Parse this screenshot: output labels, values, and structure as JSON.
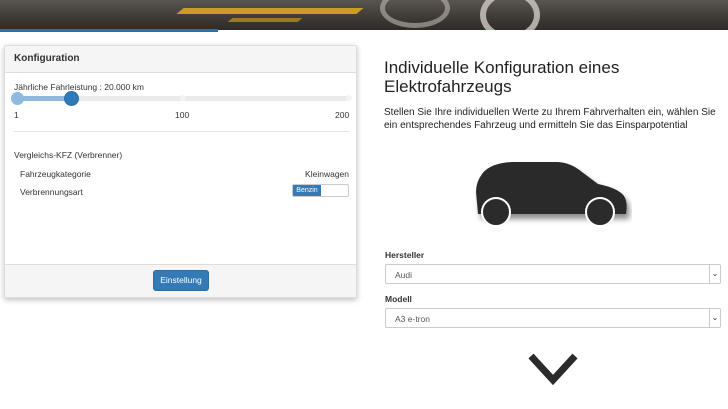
{
  "panel": {
    "title": "Konfiguration",
    "slider": {
      "label": "Jährliche Fahrleistung : 20.000 km",
      "min_label": "1",
      "mid_label": "100",
      "max_label": "200",
      "value_fraction": 0.17
    },
    "section_label": "Vergleichs-KFZ (Verbrenner)",
    "rows": [
      {
        "label": "Fahrzeugkategorie",
        "value": "Kleinwagen"
      },
      {
        "label": "Verbrennungsart",
        "toggle_on": "Benzin"
      }
    ],
    "button_label": "Einstellung"
  },
  "main": {
    "title": "Individuelle Konfiguration eines Elektrofahrzeugs",
    "description": "Stellen Sie Ihre individuellen Werte zu Ihrem Fahrverhalten ein, wählen Sie ein entsprechendes Fahrzeug und ermitteln Sie das Einsparpotential",
    "manufacturer_label": "Hersteller",
    "manufacturer_value": "Audi",
    "model_label": "Modell",
    "model_value": "A3 e-tron"
  },
  "icons": {
    "car": "car-icon",
    "scroll_down": "chevron-down-icon",
    "select_caret": "chevron-down-icon"
  },
  "colors": {
    "primary": "#337ab7",
    "accent_bar": "#2f6fa8"
  }
}
